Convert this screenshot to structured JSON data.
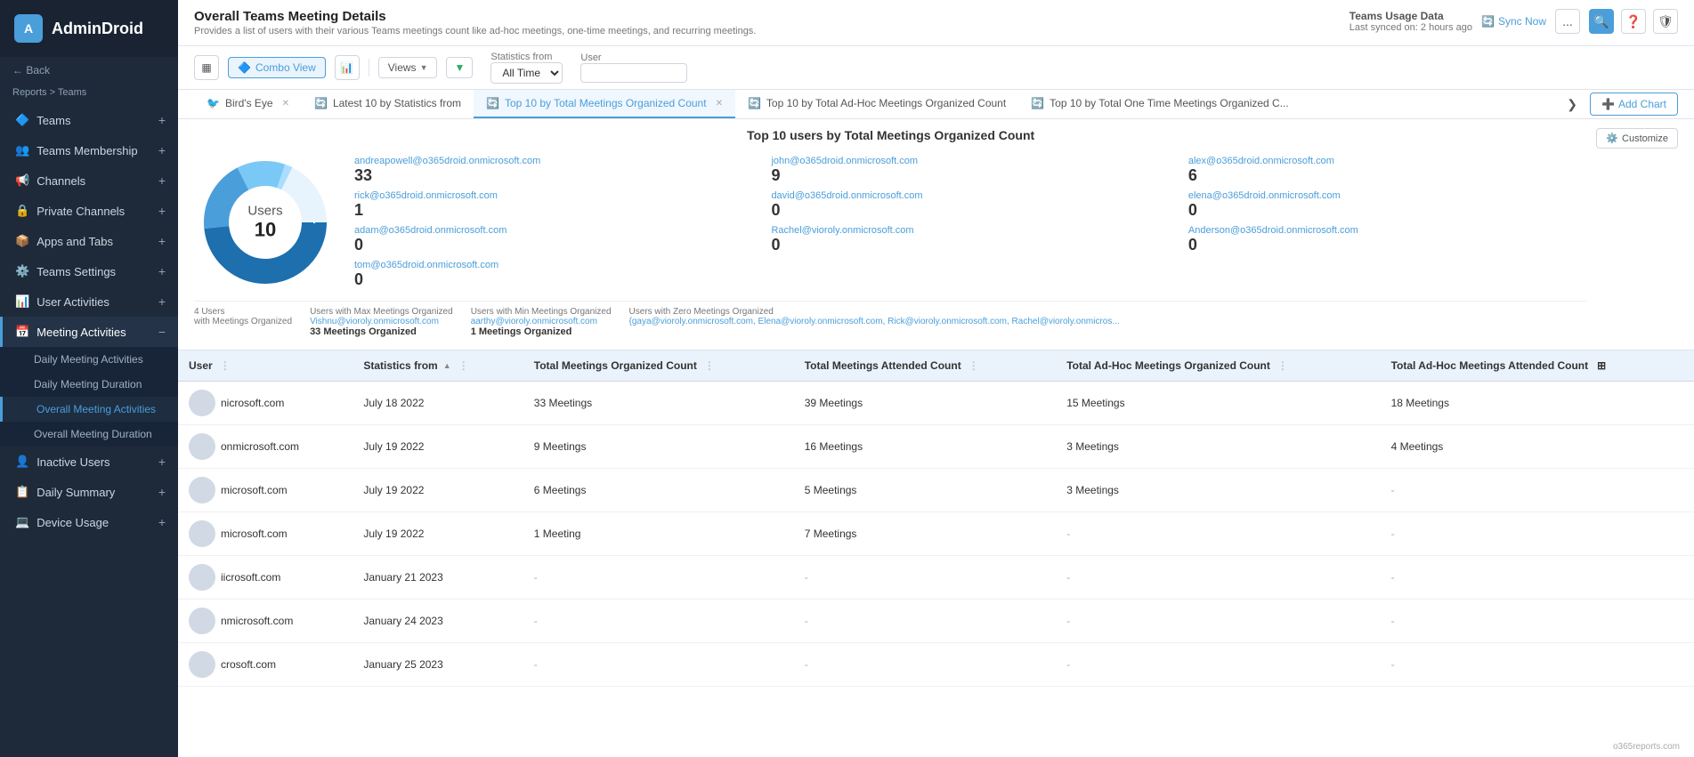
{
  "app": {
    "name": "AdminDroid"
  },
  "sidebar": {
    "breadcrumb": "Reports > Teams",
    "back_label": "← Back",
    "items": [
      {
        "id": "teams",
        "label": "Teams",
        "icon": "🔷",
        "color": "#4a9eda",
        "has_sub": false
      },
      {
        "id": "teams-membership",
        "label": "Teams Membership",
        "icon": "👥",
        "color": "#4a9eda",
        "has_sub": false
      },
      {
        "id": "channels",
        "label": "Channels",
        "icon": "📢",
        "color": "#4a9eda",
        "has_sub": false
      },
      {
        "id": "private-channels",
        "label": "Private Channels",
        "icon": "🔒",
        "color": "#4a9eda",
        "has_sub": false
      },
      {
        "id": "apps-and-tabs",
        "label": "Apps and Tabs",
        "icon": "📦",
        "color": "#4a9eda",
        "has_sub": false
      },
      {
        "id": "teams-settings",
        "label": "Teams Settings",
        "icon": "⚙️",
        "color": "#4a9eda",
        "has_sub": false
      },
      {
        "id": "user-activities",
        "label": "User Activities",
        "icon": "📊",
        "color": "#4a9eda",
        "has_sub": false
      },
      {
        "id": "meeting-activities",
        "label": "Meeting Activities",
        "icon": "📅",
        "color": "#4a9eda",
        "has_sub": true,
        "expanded": true
      },
      {
        "id": "inactive-users",
        "label": "Inactive Users",
        "icon": "👤",
        "color": "#4a9eda",
        "has_sub": false
      },
      {
        "id": "daily-summary",
        "label": "Daily Summary",
        "icon": "📋",
        "color": "#4a9eda",
        "has_sub": false
      },
      {
        "id": "device-usage",
        "label": "Device Usage",
        "icon": "💻",
        "color": "#4a9eda",
        "has_sub": false
      }
    ],
    "sub_items": [
      {
        "id": "daily-meeting-activities",
        "label": "Daily Meeting Activities"
      },
      {
        "id": "daily-meeting-duration",
        "label": "Daily Meeting Duration"
      },
      {
        "id": "overall-meeting-activities",
        "label": "Overall Meeting Activities",
        "active": true
      },
      {
        "id": "overall-meeting-duration",
        "label": "Overall Meeting Duration"
      }
    ]
  },
  "header": {
    "title": "Overall Teams Meeting Details",
    "subtitle": "Provides a list of users with their various Teams meetings count like ad-hoc meetings, one-time meetings, and recurring meetings.",
    "data_label": "Teams Usage Data",
    "sync_label": "Last synced on: 2 hours ago",
    "sync_now": "Sync Now",
    "more_btn": "...",
    "icons": [
      "🔍",
      "❓",
      "🛡"
    ]
  },
  "toolbar": {
    "grid_icon": "▦",
    "combo_view": "Combo View",
    "bar_icon": "📊",
    "views_label": "Views",
    "filter_icon": "▼",
    "stats_from_label": "Statistics from",
    "stats_value": "All Time",
    "user_label": "User",
    "user_value": ""
  },
  "tabs": [
    {
      "id": "birds-eye",
      "label": "Bird's Eye",
      "icon": "🐦",
      "active": false,
      "closable": false
    },
    {
      "id": "latest-10",
      "label": "Latest 10 by Statistics from",
      "icon": "🔄",
      "active": false,
      "closable": false
    },
    {
      "id": "top10-total",
      "label": "Top 10 by Total Meetings Organized Count",
      "icon": "🔄",
      "active": true,
      "closable": true
    },
    {
      "id": "top10-adhoc",
      "label": "Top 10 by Total Ad-Hoc Meetings Organized Count",
      "icon": "🔄",
      "active": false,
      "closable": false
    },
    {
      "id": "top10-onetime",
      "label": "Top 10 by Total One Time Meetings Organized C...",
      "icon": "🔄",
      "active": false,
      "closable": false
    }
  ],
  "chart": {
    "title": "Top 10 users by Total Meetings Organized Count",
    "donut_center_label": "Users",
    "donut_center_value": "10",
    "customize_label": "Customize",
    "add_chart_label": "Add Chart",
    "legend": [
      {
        "email": "andreapowell@o365droid.onmicrosoft.com",
        "count": "33"
      },
      {
        "email": "john@o365droid.onmicrosoft.com",
        "count": "9"
      },
      {
        "email": "alex@o365droid.onmicrosoft.com",
        "count": "6"
      },
      {
        "email": "rick@o365droid.onmicrosoft.com",
        "count": "1"
      },
      {
        "email": "david@o365droid.onmicrosoft.com",
        "count": "0"
      },
      {
        "email": "elena@o365droid.onmicrosoft.com",
        "count": "0"
      },
      {
        "email": "adam@o365droid.onmicrosoft.com",
        "count": "0"
      },
      {
        "email": "Rachel@vioroly.onmicrosoft.com",
        "count": "0"
      },
      {
        "email": "Anderson@o365droid.onmicrosoft.com",
        "count": "0"
      },
      {
        "email": "tom@o365droid.onmicrosoft.com",
        "count": "0"
      }
    ],
    "summary": [
      {
        "label": "4 Users with Meetings Organized",
        "link_label": "Vishnu@vioroly.onmicrosoft.com",
        "extra": "Users with Max Meetings Organized",
        "value": "33",
        "value_label": "Meetings Organized"
      },
      {
        "label": "Users with Min Meetings Organized",
        "link_label": "aarthy@vioroly.onmicrosoft.com",
        "value": "1",
        "value_label": "Meetings Organized"
      },
      {
        "label": "Users with Zero Meetings Organized",
        "link_label": "{gaya@vioroly.onmicrosoft.com, Elena@vioroly.onmicrosoft.com, Rick@vioroly.onmicrosoft.com, Rachel@vioroly.onmicros...",
        "value": "",
        "value_label": ""
      }
    ]
  },
  "table": {
    "columns": [
      {
        "id": "user",
        "label": "User",
        "sortable": true
      },
      {
        "id": "statistics-from",
        "label": "Statistics from",
        "sortable": true,
        "sorted": "asc"
      },
      {
        "id": "total-meetings-organized",
        "label": "Total Meetings Organized Count",
        "sortable": true
      },
      {
        "id": "total-meetings-attended",
        "label": "Total Meetings Attended Count",
        "sortable": true
      },
      {
        "id": "total-adhoc-organized",
        "label": "Total Ad-Hoc Meetings Organized Count",
        "sortable": true
      },
      {
        "id": "total-adhoc-attended",
        "label": "Total Ad-Hoc Meetings Attended Count",
        "sortable": true
      }
    ],
    "rows": [
      {
        "user": "nicrosoft.com",
        "stats_from": "July 18 2022",
        "organized": "33 Meetings",
        "attended": "39 Meetings",
        "adhoc_org": "15 Meetings",
        "adhoc_att": "18 Meetings"
      },
      {
        "user": "onmicrosoft.com",
        "stats_from": "July 19 2022",
        "organized": "9 Meetings",
        "attended": "16 Meetings",
        "adhoc_org": "3 Meetings",
        "adhoc_att": "4 Meetings"
      },
      {
        "user": "microsoft.com",
        "stats_from": "July 19 2022",
        "organized": "6 Meetings",
        "attended": "5 Meetings",
        "adhoc_org": "3 Meetings",
        "adhoc_att": "-"
      },
      {
        "user": "microsoft.com",
        "stats_from": "July 19 2022",
        "organized": "1 Meeting",
        "attended": "7 Meetings",
        "adhoc_org": "-",
        "adhoc_att": "-"
      },
      {
        "user": "iicrosoft.com",
        "stats_from": "January 21 2023",
        "organized": "-",
        "attended": "-",
        "adhoc_org": "-",
        "adhoc_att": "-"
      },
      {
        "user": "nmicrosoft.com",
        "stats_from": "January 24 2023",
        "organized": "-",
        "attended": "-",
        "adhoc_org": "-",
        "adhoc_att": "-"
      },
      {
        "user": "crosoft.com",
        "stats_from": "January 25 2023",
        "organized": "-",
        "attended": "-",
        "adhoc_org": "-",
        "adhoc_att": "-"
      }
    ]
  },
  "footer": {
    "brand": "o365reports.com"
  }
}
